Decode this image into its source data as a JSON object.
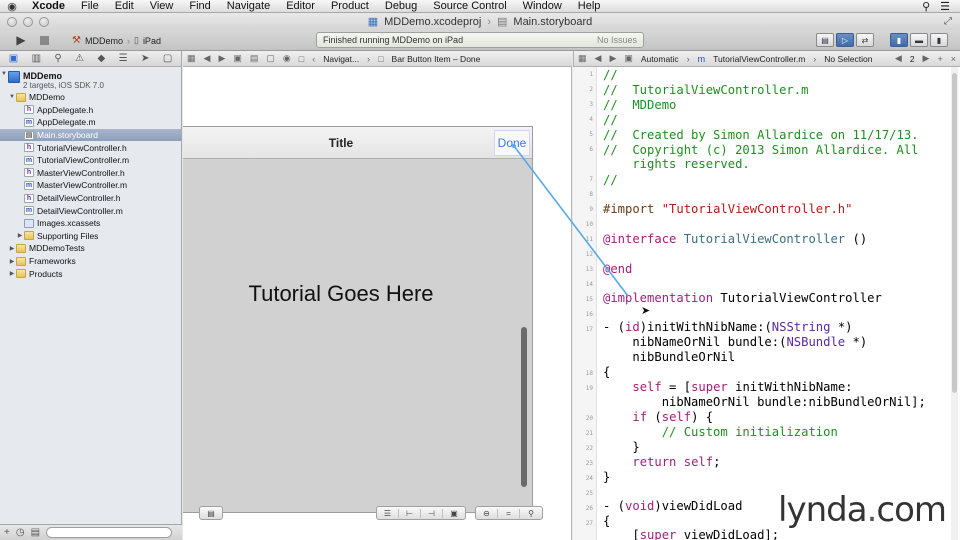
{
  "menubar": {
    "app": "Xcode",
    "items": [
      "File",
      "Edit",
      "View",
      "Find",
      "Navigate",
      "Editor",
      "Product",
      "Debug",
      "Source Control",
      "Window",
      "Help"
    ]
  },
  "titlebar": {
    "project": "MDDemo.xcodeproj",
    "file": "Main.storyboard"
  },
  "toolbar": {
    "scheme": "MDDemo",
    "device": "iPad",
    "status": "Finished running MDDemo on iPad",
    "issues": "No Issues"
  },
  "navigator": {
    "project_name": "MDDemo",
    "project_sub": "2 targets, iOS SDK 7.0",
    "items": [
      {
        "label": "MDDemo",
        "type": "folder"
      },
      {
        "label": "AppDelegate.h",
        "type": "h"
      },
      {
        "label": "AppDelegate.m",
        "type": "m"
      },
      {
        "label": "Main.storyboard",
        "type": "sb"
      },
      {
        "label": "TutorialViewController.h",
        "type": "h"
      },
      {
        "label": "TutorialViewController.m",
        "type": "m"
      },
      {
        "label": "MasterViewController.h",
        "type": "h"
      },
      {
        "label": "MasterViewController.m",
        "type": "m"
      },
      {
        "label": "DetailViewController.h",
        "type": "h"
      },
      {
        "label": "DetailViewController.m",
        "type": "m"
      },
      {
        "label": "Images.xcassets",
        "type": "xc"
      },
      {
        "label": "Supporting Files",
        "type": "folder"
      },
      {
        "label": "MDDemoTests",
        "type": "folder"
      },
      {
        "label": "Frameworks",
        "type": "folder"
      },
      {
        "label": "Products",
        "type": "folder"
      }
    ]
  },
  "storyboard_jumpbar": {
    "crumb1": "Navigat...",
    "crumb2": "Bar Button Item – Done"
  },
  "editor_jumpbar": {
    "mode": "Automatic",
    "file": "TutorialViewController.m",
    "selection": "No Selection",
    "count": "2"
  },
  "canvas": {
    "nav_title": "Title",
    "done_label": "Done",
    "body_label": "Tutorial Goes Here"
  },
  "code": {
    "line_numbers": [
      "1",
      "2",
      "3",
      "4",
      "5",
      "6",
      "7",
      "8",
      "9",
      "10",
      "11",
      "12",
      "13",
      "14",
      "15",
      "16",
      "17",
      "18",
      "19",
      "20",
      "21",
      "22",
      "23",
      "24",
      "25",
      "26",
      "27"
    ],
    "comment1": "//",
    "comment2": "//  TutorialViewController.m",
    "comment3": "//  MDDemo",
    "comment4": "//",
    "comment5": "//  Created by Simon Allardice on 11/17/13.",
    "comment6": "//  Copyright (c) 2013 Simon Allardice. All",
    "comment7": "    rights reserved.",
    "comment8": "//",
    "import_kw": "#import",
    "import_file": " \"TutorialViewController.h\"",
    "interface_kw": "@interface",
    "interface_name": " TutorialViewController",
    "interface_rest": " ()",
    "end_kw": "@end",
    "impl_kw": "@implementation",
    "impl_name": " TutorialViewController",
    "m1a": "- (",
    "m1b": "id",
    "m1c": ")initWithNibName:(",
    "m1d": "NSString",
    "m1e": " *)",
    "m2a": "    nibNameOrNil bundle:(",
    "m2b": "NSBundle",
    "m2c": " *)",
    "m3": "    nibBundleOrNil",
    "brace_open": "{",
    "s1a": "    ",
    "s1b": "self",
    "s1c": " = [",
    "s1d": "super",
    "s1e": " initWithNibName:",
    "s2": "        nibNameOrNil bundle:nibBundleOrNil];",
    "s3a": "    ",
    "s3b": "if",
    "s3c": " (",
    "s3d": "self",
    "s3e": ") {",
    "s4": "        // Custom initialization",
    "s5": "    }",
    "s6a": "    ",
    "s6b": "return",
    "s6c": " ",
    "s6d": "self",
    "s6e": ";",
    "brace_close": "}",
    "v1a": "- (",
    "v1b": "void",
    "v1c": ")viewDidLoad",
    "v2": "{",
    "v3a": "    [",
    "v3b": "super",
    "v3c": " viewDidLoad];"
  },
  "watermark": {
    "brand": "lynda",
    "dot": ".",
    "tld": "com"
  }
}
